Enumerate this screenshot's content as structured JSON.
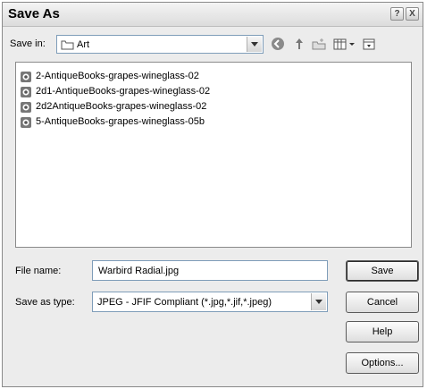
{
  "window": {
    "title": "Save As"
  },
  "titlebar": {
    "help_glyph": "?",
    "close_glyph": "X"
  },
  "save_in": {
    "label": "Save in:",
    "label_mnemonic": "i",
    "value": "Art"
  },
  "toolbar": {
    "icons": [
      "back-icon",
      "up-folder-icon",
      "new-folder-icon",
      "view-menu-icon",
      "tools-icon"
    ]
  },
  "files": [
    {
      "name": "2-AntiqueBooks-grapes-wineglass-02"
    },
    {
      "name": "2d1-AntiqueBooks-grapes-wineglass-02"
    },
    {
      "name": "2d2AntiqueBooks-grapes-wineglass-02"
    },
    {
      "name": "5-AntiqueBooks-grapes-wineglass-05b"
    }
  ],
  "file_name": {
    "label": "File name:",
    "value": "Warbird Radial.jpg"
  },
  "save_as_type": {
    "label": "Save as type:",
    "value": "JPEG - JFIF Compliant (*.jpg,*.jif,*.jpeg)"
  },
  "buttons": {
    "save": "Save",
    "cancel": "Cancel",
    "help": "Help",
    "options": "Options..."
  },
  "colors": {
    "dialog_bg": "#ececec",
    "border": "#7f9db9"
  }
}
